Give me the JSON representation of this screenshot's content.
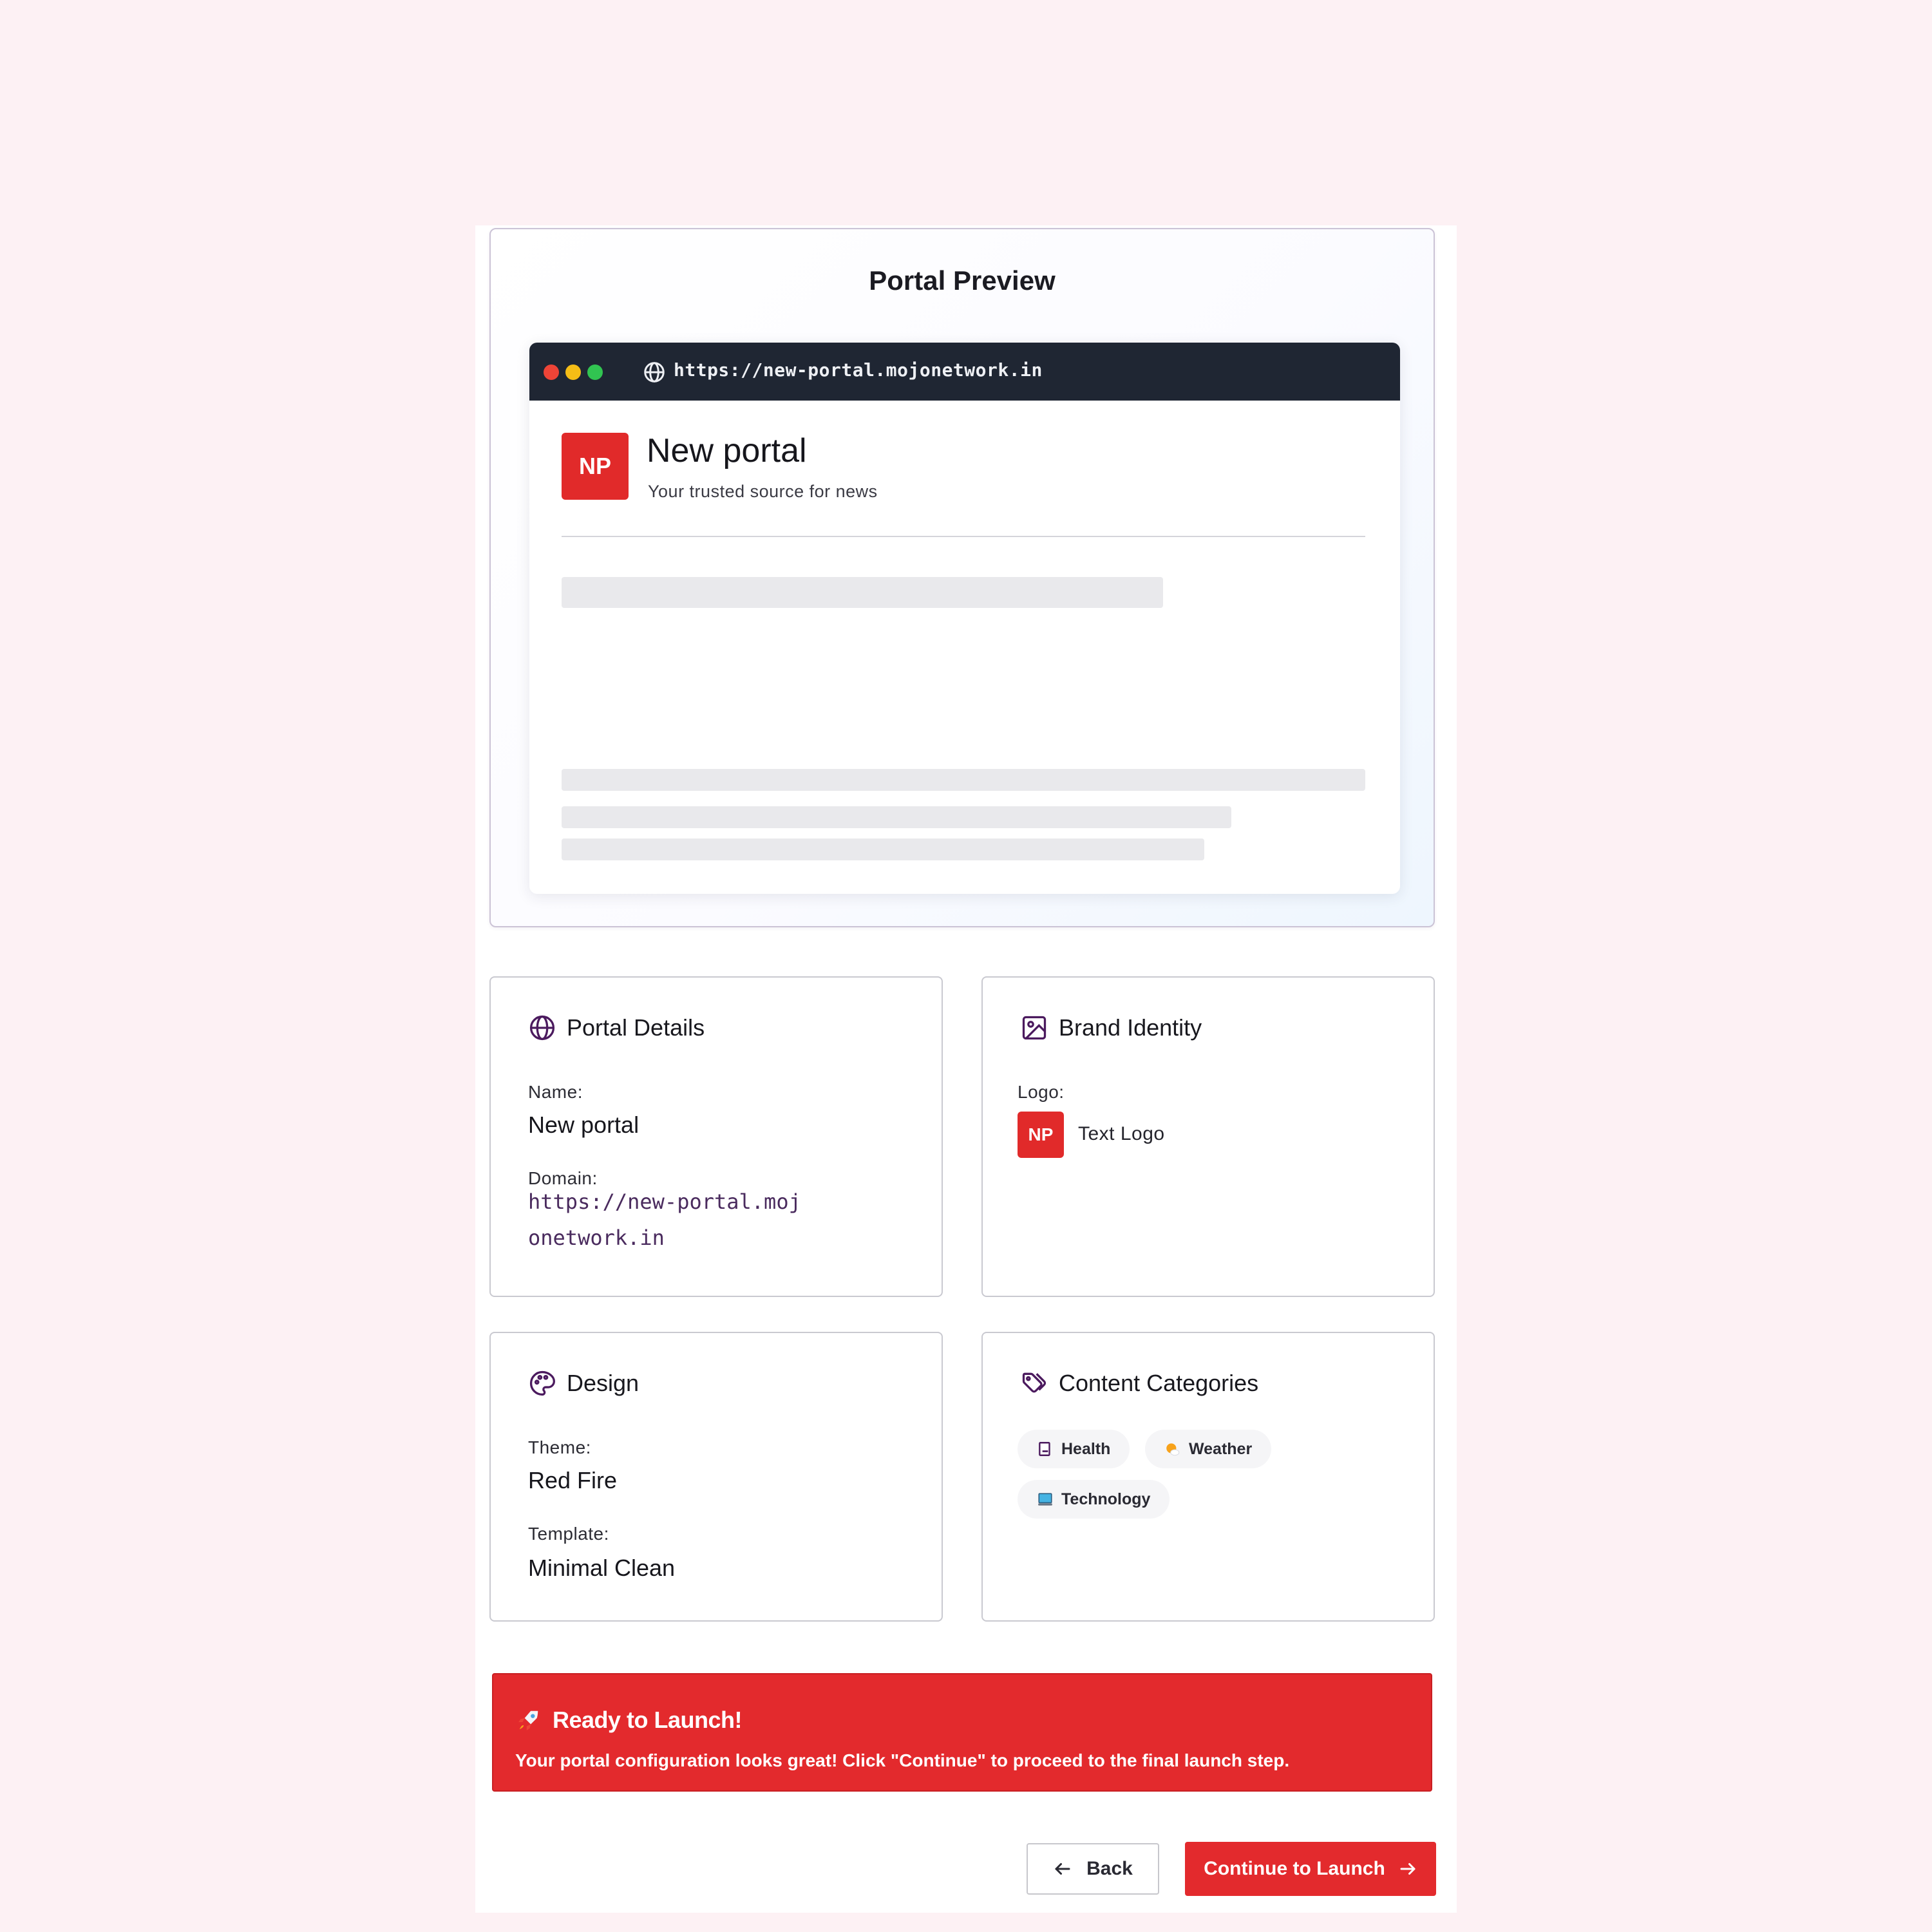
{
  "preview": {
    "title": "Portal Preview",
    "url": "https://new-portal.mojonetwork.in",
    "logo_text": "NP",
    "site_name": "New portal",
    "tagline": "Your trusted source for news"
  },
  "portal_details": {
    "title": "Portal Details",
    "name_label": "Name:",
    "name_value": "New portal",
    "domain_label": "Domain:",
    "domain_value": "https://new-portal.mojonetwork.in"
  },
  "brand_identity": {
    "title": "Brand Identity",
    "logo_label": "Logo:",
    "logo_badge": "NP",
    "logo_type": "Text Logo"
  },
  "design": {
    "title": "Design",
    "theme_label": "Theme:",
    "theme_value": "Red Fire",
    "template_label": "Template:",
    "template_value": "Minimal Clean"
  },
  "categories": {
    "title": "Content Categories",
    "items": [
      {
        "label": "Health",
        "icon": "health-icon"
      },
      {
        "label": "Weather",
        "icon": "weather-icon"
      },
      {
        "label": "Technology",
        "icon": "technology-icon"
      }
    ]
  },
  "launch": {
    "title": "Ready to Launch!",
    "message": "Your portal configuration looks great! Click \"Continue\" to proceed to the final launch step."
  },
  "buttons": {
    "back": "Back",
    "continue": "Continue to Launch"
  },
  "colors": {
    "accent": "#e32a2d",
    "icon_purple": "#4b1a5e",
    "page_bg": "#fdf1f4"
  }
}
